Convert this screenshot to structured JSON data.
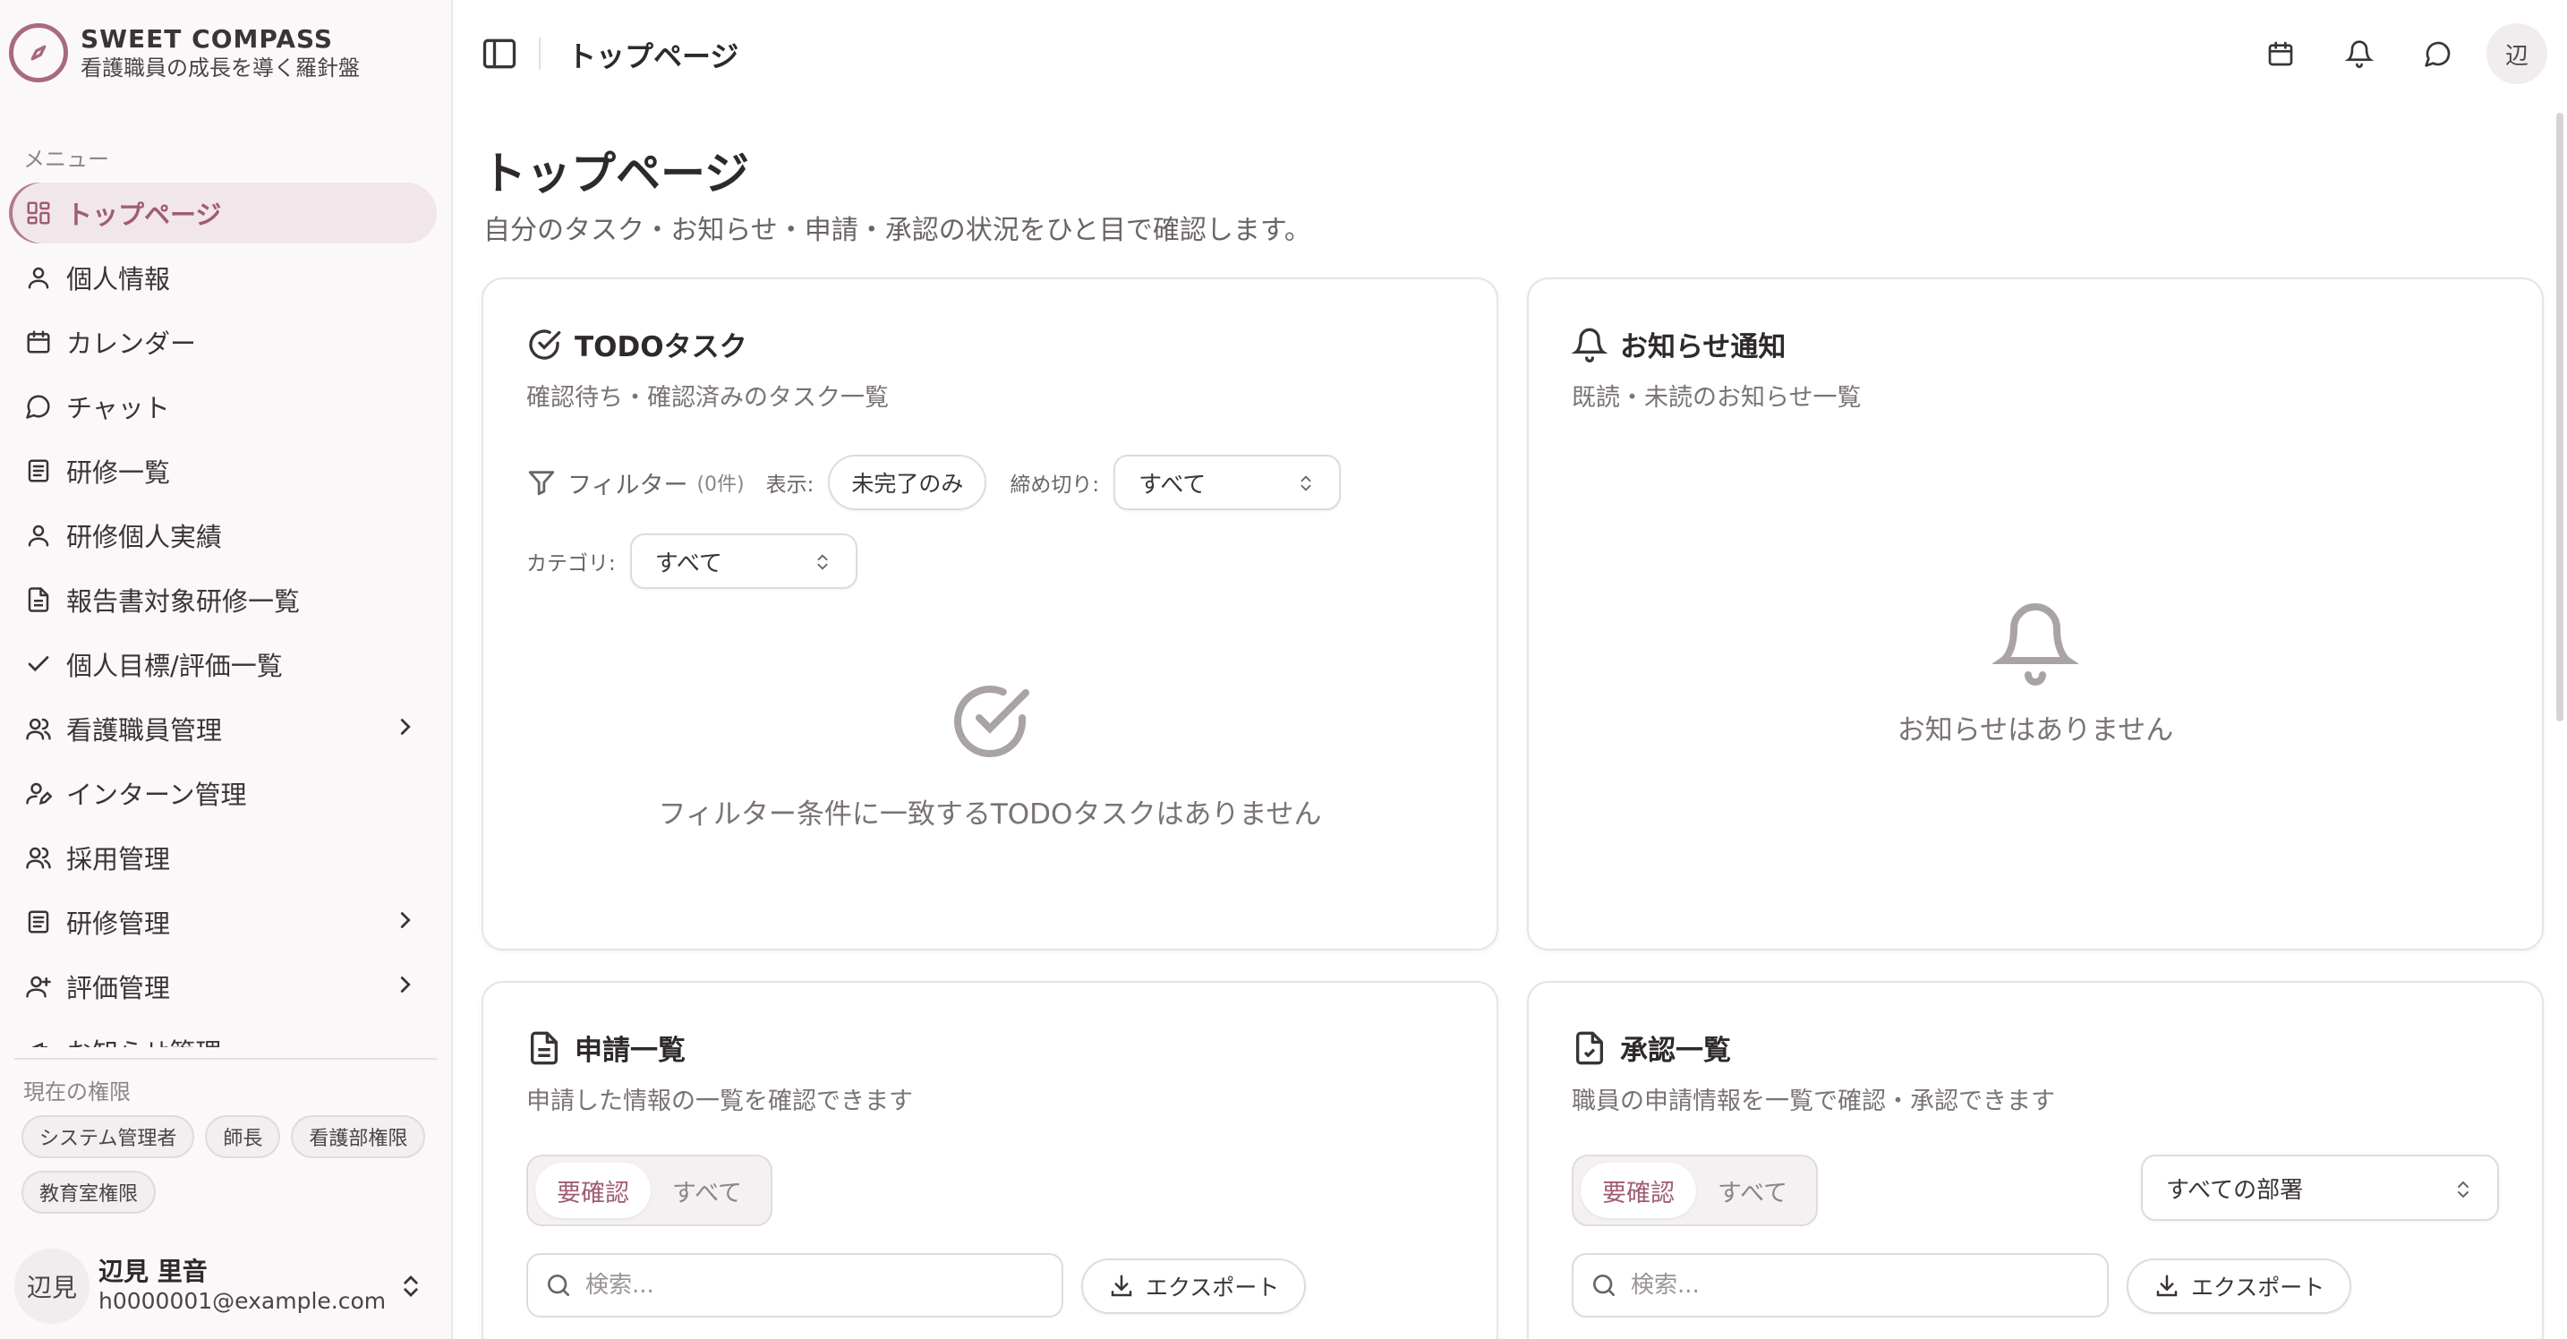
{
  "brand": {
    "title": "SWEET COMPASS",
    "subtitle": "看護職員の成長を導く羅針盤"
  },
  "sidebar": {
    "menu_label": "メニュー",
    "items": [
      {
        "label": "トップページ",
        "icon": "grid-icon",
        "active": true
      },
      {
        "label": "個人情報",
        "icon": "user-icon"
      },
      {
        "label": "カレンダー",
        "icon": "calendar-icon"
      },
      {
        "label": "チャット",
        "icon": "chat-icon"
      },
      {
        "label": "研修一覧",
        "icon": "book-icon"
      },
      {
        "label": "研修個人実績",
        "icon": "user-icon"
      },
      {
        "label": "報告書対象研修一覧",
        "icon": "document-icon"
      },
      {
        "label": "個人目標/評価一覧",
        "icon": "check-icon"
      },
      {
        "label": "看護職員管理",
        "icon": "users-icon",
        "expandable": true
      },
      {
        "label": "インターン管理",
        "icon": "user-pen-icon"
      },
      {
        "label": "採用管理",
        "icon": "users-icon"
      },
      {
        "label": "研修管理",
        "icon": "book-icon",
        "expandable": true
      },
      {
        "label": "評価管理",
        "icon": "user-plus-icon",
        "expandable": true
      },
      {
        "label": "お知らせ管理",
        "icon": "megaphone-icon"
      }
    ],
    "permission_label": "現在の権限",
    "permissions": [
      "システム管理者",
      "師長",
      "看護部権限",
      "教育室権限"
    ],
    "user": {
      "avatar": "辺見",
      "name": "辺見 里音",
      "email": "h0000001@example.com"
    }
  },
  "header": {
    "title": "トップページ",
    "avatar": "辺"
  },
  "page": {
    "title": "トップページ",
    "subtitle": "自分のタスク・お知らせ・申請・承認の状況をひと目で確認します。"
  },
  "todo": {
    "title": "TODOタスク",
    "subtitle": "確認待ち・確認済みのタスク一覧",
    "filter_label": "フィルター",
    "filter_count": "(0件)",
    "display_label": "表示:",
    "display_value": "未完了のみ",
    "deadline_label": "締め切り:",
    "deadline_value": "すべて",
    "category_label": "カテゴリ:",
    "category_value": "すべて",
    "empty_text": "フィルター条件に一致するTODOタスクはありません"
  },
  "notice": {
    "title": "お知らせ通知",
    "subtitle": "既読・未読のお知らせ一覧",
    "empty_text": "お知らせはありません"
  },
  "applications": {
    "title": "申請一覧",
    "subtitle": "申請した情報の一覧を確認できます",
    "tab_required": "要確認",
    "tab_all": "すべて",
    "search_placeholder": "検索...",
    "export_label": "エクスポート"
  },
  "approvals": {
    "title": "承認一覧",
    "subtitle": "職員の申請情報を一覧で確認・承認できます",
    "tab_required": "要確認",
    "tab_all": "すべて",
    "department_value": "すべての部署",
    "search_placeholder": "検索...",
    "export_label": "エクスポート"
  },
  "colors": {
    "accent": "#a05c72",
    "active_bg": "#f1e7ea",
    "border": "#e1dadc"
  }
}
